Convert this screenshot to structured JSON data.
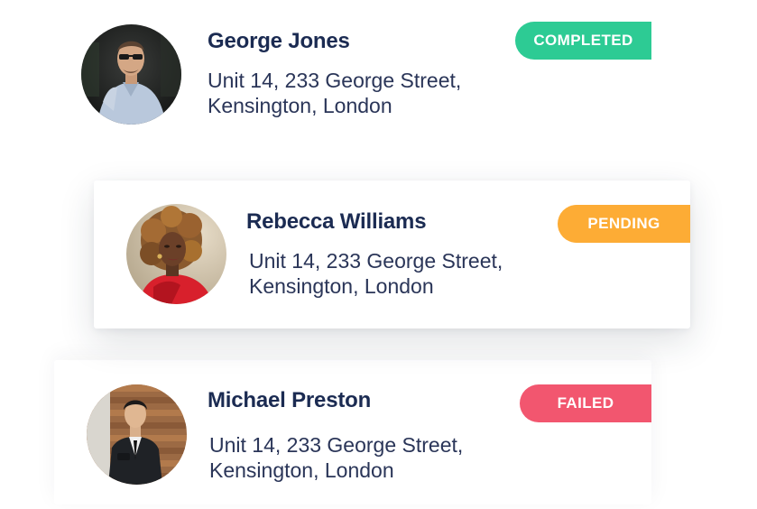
{
  "contacts": [
    {
      "name": "George Jones",
      "address_line1": "Unit 14, 233 George Street,",
      "address_line2": "Kensington, London",
      "status": "COMPLETED",
      "status_color": "#2dcb94",
      "avatar_icon": "man-in-sunglasses-photo"
    },
    {
      "name": "Rebecca Williams",
      "address_line1": "Unit 14, 233 George Street,",
      "address_line2": "Kensington, London",
      "status": "PENDING",
      "status_color": "#fdac35",
      "avatar_icon": "woman-with-curly-hair-photo"
    },
    {
      "name": "Michael Preston",
      "address_line1": "Unit 14, 233 George Street,",
      "address_line2": "Kensington, London",
      "status": "FAILED",
      "status_color": "#f2566f",
      "avatar_icon": "man-in-suit-photo"
    }
  ],
  "colors": {
    "name_text": "#1b2b52",
    "address_text": "#2a3558",
    "card_background": "#ffffff"
  }
}
